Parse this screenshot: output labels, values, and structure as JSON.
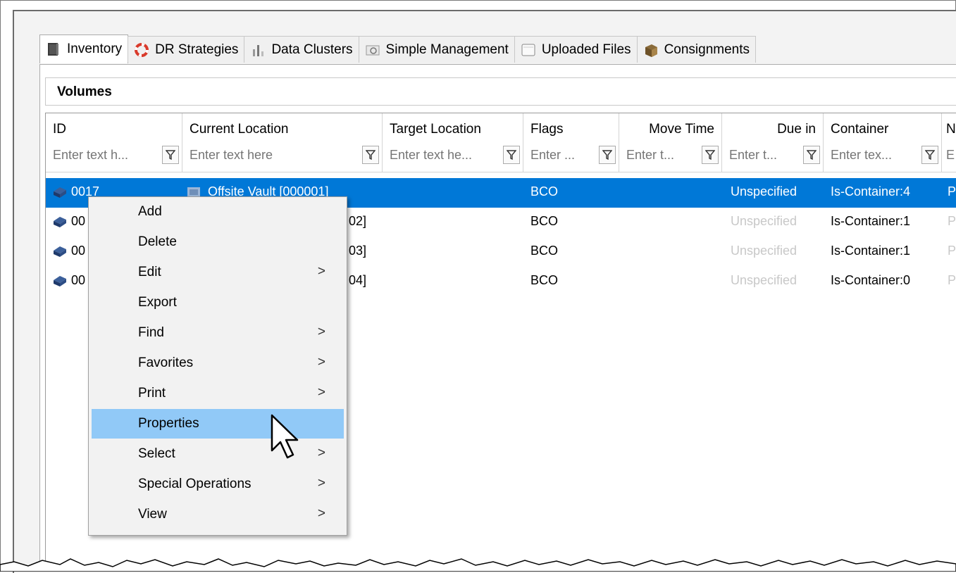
{
  "tabs": [
    {
      "label": "Inventory",
      "icon": "inventory-book-icon",
      "active": true
    },
    {
      "label": "DR Strategies",
      "icon": "lifebuoy-icon"
    },
    {
      "label": "Data Clusters",
      "icon": "data-clusters-icon"
    },
    {
      "label": "Simple Management",
      "icon": "simple-management-icon"
    },
    {
      "label": "Uploaded Files",
      "icon": "uploaded-files-icon"
    },
    {
      "label": "Consignments",
      "icon": "box-icon"
    }
  ],
  "section": {
    "title": "Volumes"
  },
  "grid": {
    "columns": [
      {
        "label": "ID",
        "filter_placeholder": "Enter text h..."
      },
      {
        "label": "Current Location",
        "filter_placeholder": "Enter text here"
      },
      {
        "label": "Target Location",
        "filter_placeholder": "Enter text he..."
      },
      {
        "label": "Flags",
        "filter_placeholder": "Enter ..."
      },
      {
        "label": "Move Time",
        "filter_placeholder": "Enter t..."
      },
      {
        "label": "Due in",
        "filter_placeholder": "Enter t..."
      },
      {
        "label": "Container",
        "filter_placeholder": "Enter tex..."
      },
      {
        "label": "N",
        "filter_placeholder": "E"
      }
    ],
    "rows": [
      {
        "id": "0017",
        "current_location": "Offsite Vault [000001]",
        "flags": "BCO",
        "due_in": "Unspecified",
        "container": "Is-Container:4",
        "extra": "P",
        "selected": true
      },
      {
        "id": "00",
        "current_location": "02]",
        "flags": "BCO",
        "due_in": "Unspecified",
        "container": "Is-Container:1",
        "extra": "P"
      },
      {
        "id": "00",
        "current_location": "03]",
        "flags": "BCO",
        "due_in": "Unspecified",
        "container": "Is-Container:1",
        "extra": "P"
      },
      {
        "id": "00",
        "current_location": "04]",
        "flags": "BCO",
        "due_in": "Unspecified",
        "container": "Is-Container:0",
        "extra": "P"
      }
    ]
  },
  "context_menu": {
    "items": [
      {
        "label": "Add",
        "submenu": false
      },
      {
        "label": "Delete",
        "submenu": false
      },
      {
        "label": "Edit",
        "submenu": true
      },
      {
        "label": "Export",
        "submenu": false
      },
      {
        "label": "Find",
        "submenu": true
      },
      {
        "label": "Favorites",
        "submenu": true
      },
      {
        "label": "Print",
        "submenu": true
      },
      {
        "label": "Properties",
        "submenu": false,
        "highlighted": true
      },
      {
        "label": "Select",
        "submenu": true
      },
      {
        "label": "Special Operations",
        "submenu": true
      },
      {
        "label": "View",
        "submenu": true
      }
    ],
    "submenu_arrow": ">"
  },
  "colors": {
    "selection": "#0078d7",
    "menu_hover": "#91c9f7",
    "muted_text": "#c8c8c8"
  }
}
